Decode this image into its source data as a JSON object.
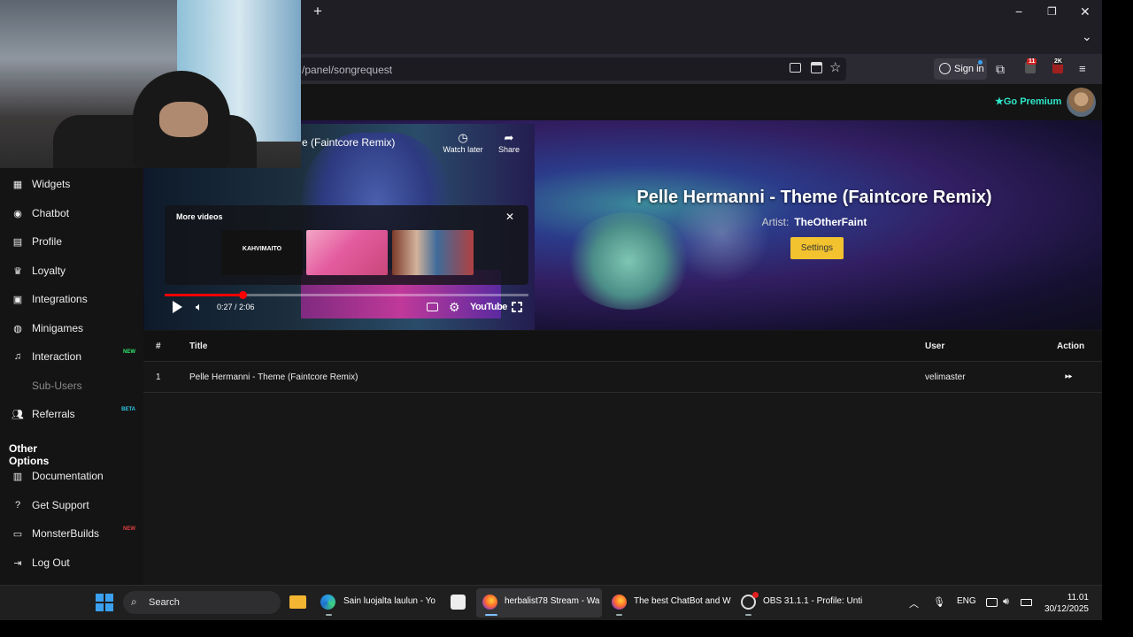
{
  "browser": {
    "new_tab": "+",
    "url": "/panel/songrequest",
    "sign_in": "Sign in",
    "ext_badge_1": "11",
    "ext_badge_2": "2K",
    "window_min": "−",
    "window_restore": "❐",
    "window_close": "✕",
    "tabs_dropdown": "⌄"
  },
  "site": {
    "go_premium": "Go Premium"
  },
  "sidebar": {
    "items": [
      {
        "label": "Widgets",
        "icon": "grid-icon"
      },
      {
        "label": "Chatbot",
        "icon": "robot-icon"
      },
      {
        "label": "Profile",
        "icon": "id-card-icon"
      },
      {
        "label": "Loyalty",
        "icon": "trophy-icon"
      },
      {
        "label": "Integrations",
        "icon": "integration-icon"
      },
      {
        "label": "Minigames",
        "icon": "gamepad-icon"
      },
      {
        "label": "Interaction",
        "icon": "music-note-icon",
        "badge": "NEW"
      },
      {
        "label": "Sub-Users",
        "icon": "",
        "dim": true
      },
      {
        "label": "Referrals",
        "icon": "users-icon",
        "badge": "BETA"
      }
    ],
    "other_options_title": "Other Options",
    "other_items": [
      {
        "label": "Documentation",
        "icon": "document-icon"
      },
      {
        "label": "Get Support",
        "icon": "question-icon"
      },
      {
        "label": "MonsterBuilds",
        "icon": "laptop-icon",
        "badge": "NEW"
      },
      {
        "label": "Log Out",
        "icon": "logout-icon"
      }
    ],
    "badge_colors": {
      "new": "#2ee66b",
      "beta": "#2ec8e6",
      "red": "#e04040"
    }
  },
  "player": {
    "video_title": "e (Faintcore Remix)",
    "watch_later": "Watch later",
    "share": "Share",
    "more_videos": "More videos",
    "thumb1_text": "KAHVIMAITO",
    "time": "0:27 / 2:06",
    "progress": 0.214,
    "youtube": "YouTube"
  },
  "now_playing": {
    "title": "Pelle Hermanni - Theme (Faintcore Remix)",
    "artist_label": "Artist:",
    "artist": "TheOtherFaint",
    "settings_button": "Settings"
  },
  "queue": {
    "headers": {
      "num": "#",
      "title": "Title",
      "user": "User",
      "action": "Action"
    },
    "rows": [
      {
        "num": "1",
        "title": "Pelle Hermanni - Theme (Faintcore Remix)",
        "user": "velimaster"
      }
    ]
  },
  "taskbar": {
    "search": "Search",
    "apps": [
      {
        "label": "Sain luojalta laulun - Yo"
      },
      {
        "label": "herbalist78 Stream - Wa"
      },
      {
        "label": "The best ChatBot and W"
      },
      {
        "label": "OBS 31.1.1 - Profile: Unti"
      }
    ],
    "lang": "ENG",
    "time": "11.01",
    "date": "30/12/2025"
  },
  "colors": {
    "accent_teal": "#2ee6c8",
    "settings_yellow": "#f2c22f",
    "progress_red": "#ff0000"
  }
}
